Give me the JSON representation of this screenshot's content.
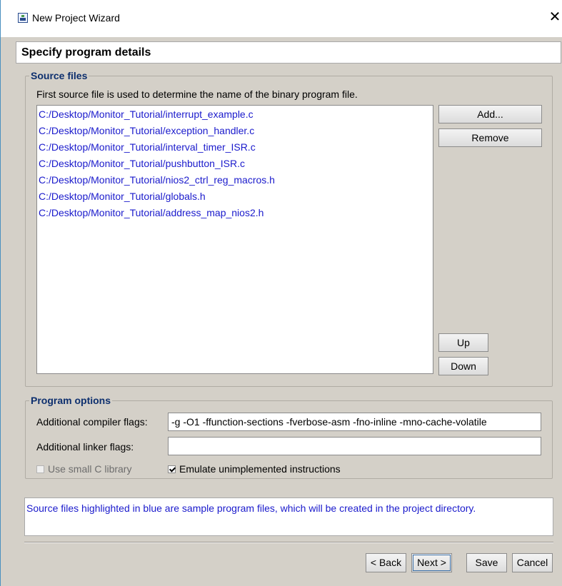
{
  "window": {
    "title": "New Project Wizard",
    "close_glyph": "✕"
  },
  "step": {
    "title": "Specify program details"
  },
  "source_files": {
    "legend": "Source files",
    "hint": "First source file is used to determine the name of the binary program file.",
    "files": [
      "C:/Desktop/Monitor_Tutorial/interrupt_example.c",
      "C:/Desktop/Monitor_Tutorial/exception_handler.c",
      "C:/Desktop/Monitor_Tutorial/interval_timer_ISR.c",
      "C:/Desktop/Monitor_Tutorial/pushbutton_ISR.c",
      "C:/Desktop/Monitor_Tutorial/nios2_ctrl_reg_macros.h",
      "C:/Desktop/Monitor_Tutorial/globals.h",
      "C:/Desktop/Monitor_Tutorial/address_map_nios2.h"
    ],
    "file_color": "#1a1acc",
    "add_label": "Add...",
    "remove_label": "Remove",
    "up_label": "Up",
    "down_label": "Down"
  },
  "program_options": {
    "legend": "Program options",
    "compiler_flags_label": "Additional compiler flags:",
    "compiler_flags_value": "-g -O1 -ffunction-sections -fverbose-asm -fno-inline -mno-cache-volatile",
    "linker_flags_label": "Additional linker flags:",
    "linker_flags_value": "",
    "small_c_library": {
      "label": "Use small C library",
      "checked": false,
      "enabled": false
    },
    "emulate_instructions": {
      "label": "Emulate unimplemented instructions",
      "checked": true,
      "enabled": true
    }
  },
  "message": "Source files highlighted in blue are sample program files, which will be created in the project directory.",
  "footer": {
    "back_label": "< Back",
    "next_label": "Next >",
    "save_label": "Save",
    "cancel_label": "Cancel"
  }
}
